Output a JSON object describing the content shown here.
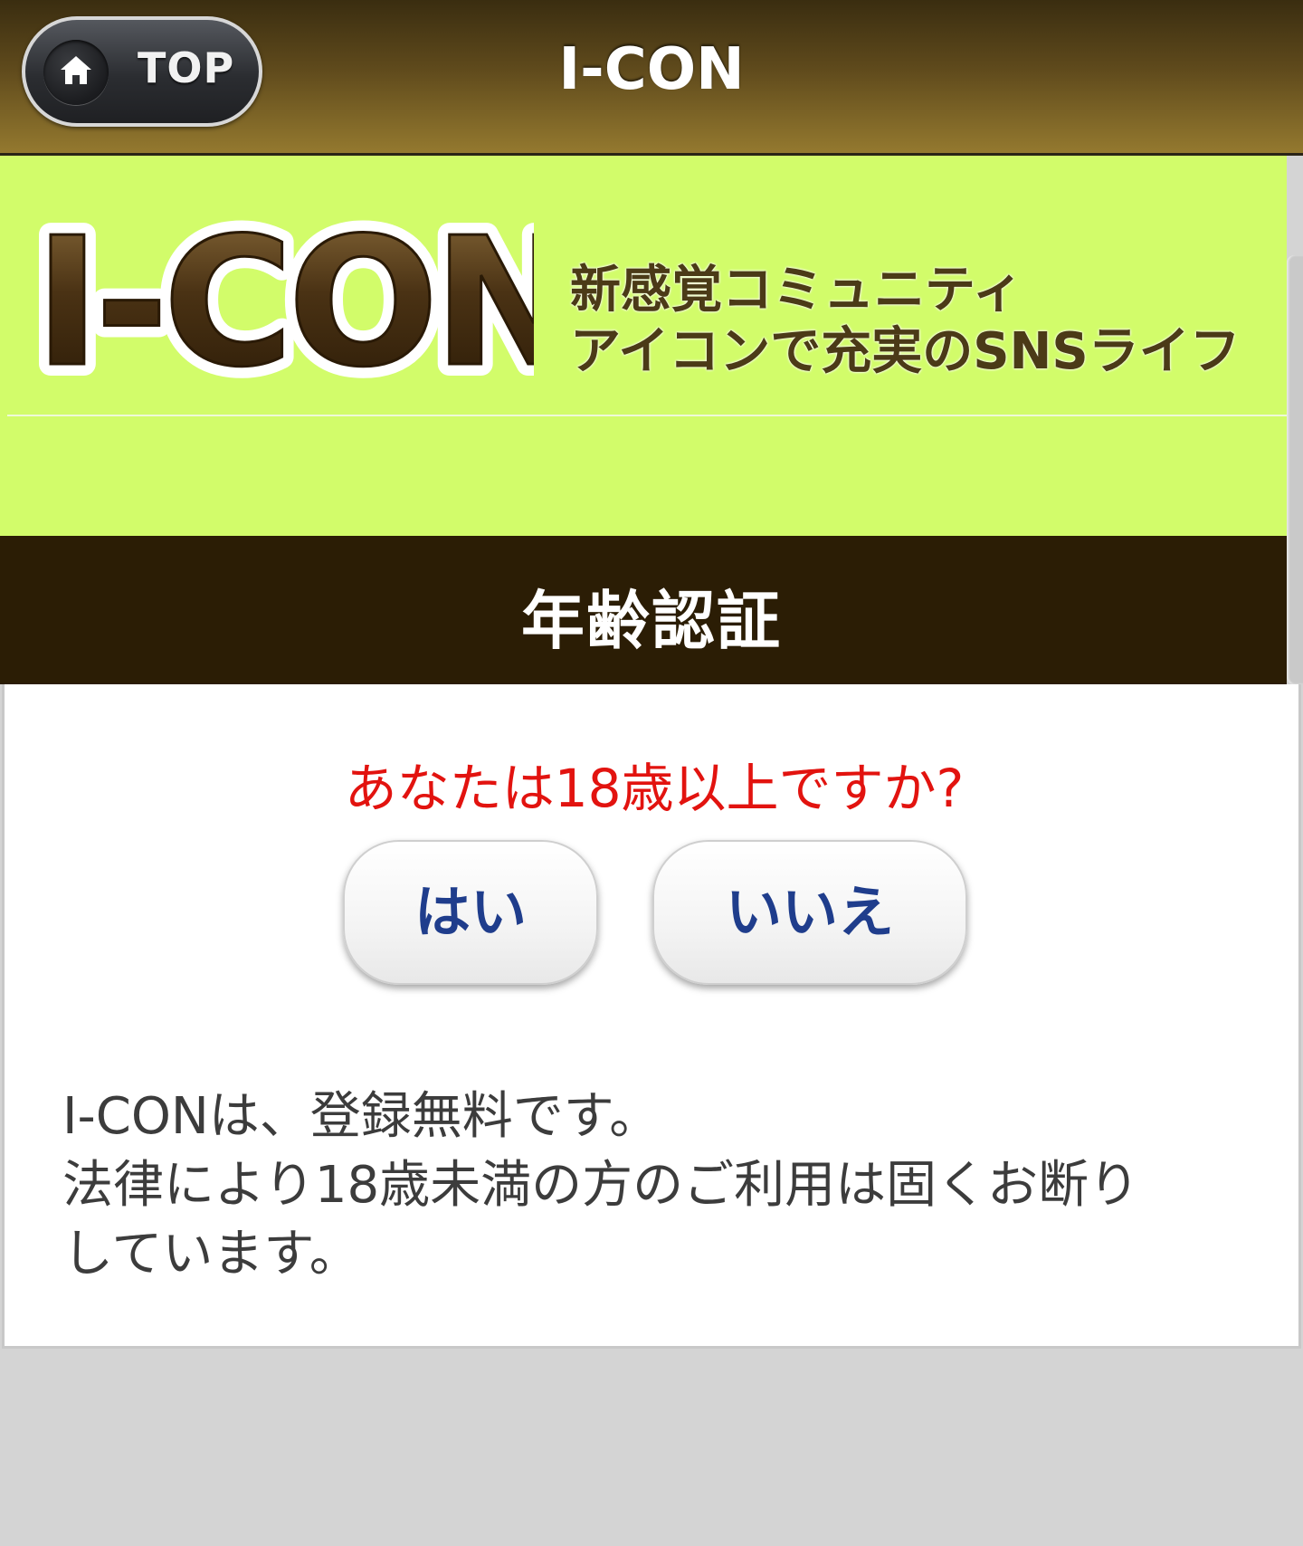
{
  "header": {
    "top_button_label": "TOP",
    "title": "I-CON"
  },
  "banner": {
    "logo_text": "I-CON",
    "tagline_line1": "新感覚コミュニティ",
    "tagline_line2": "アイコンで充実のSNSライフ"
  },
  "section": {
    "title": "年齢認証"
  },
  "age_check": {
    "question": "あなたは18歳以上ですか?",
    "yes_label": "はい",
    "no_label": "いいえ",
    "notice_line1": "I-CONは、登録無料です。",
    "notice_line2": "法律により18歳未満の方のご利用は固くお断り",
    "notice_line3": "しています。"
  },
  "colors": {
    "banner_bg": "#d2fc6a",
    "section_bar_bg": "#2b1d05",
    "question_text": "#e2130f",
    "button_text": "#1f3d8c",
    "logo_brown": "#4b3a17"
  },
  "icons": {
    "top_button": "home-icon"
  }
}
